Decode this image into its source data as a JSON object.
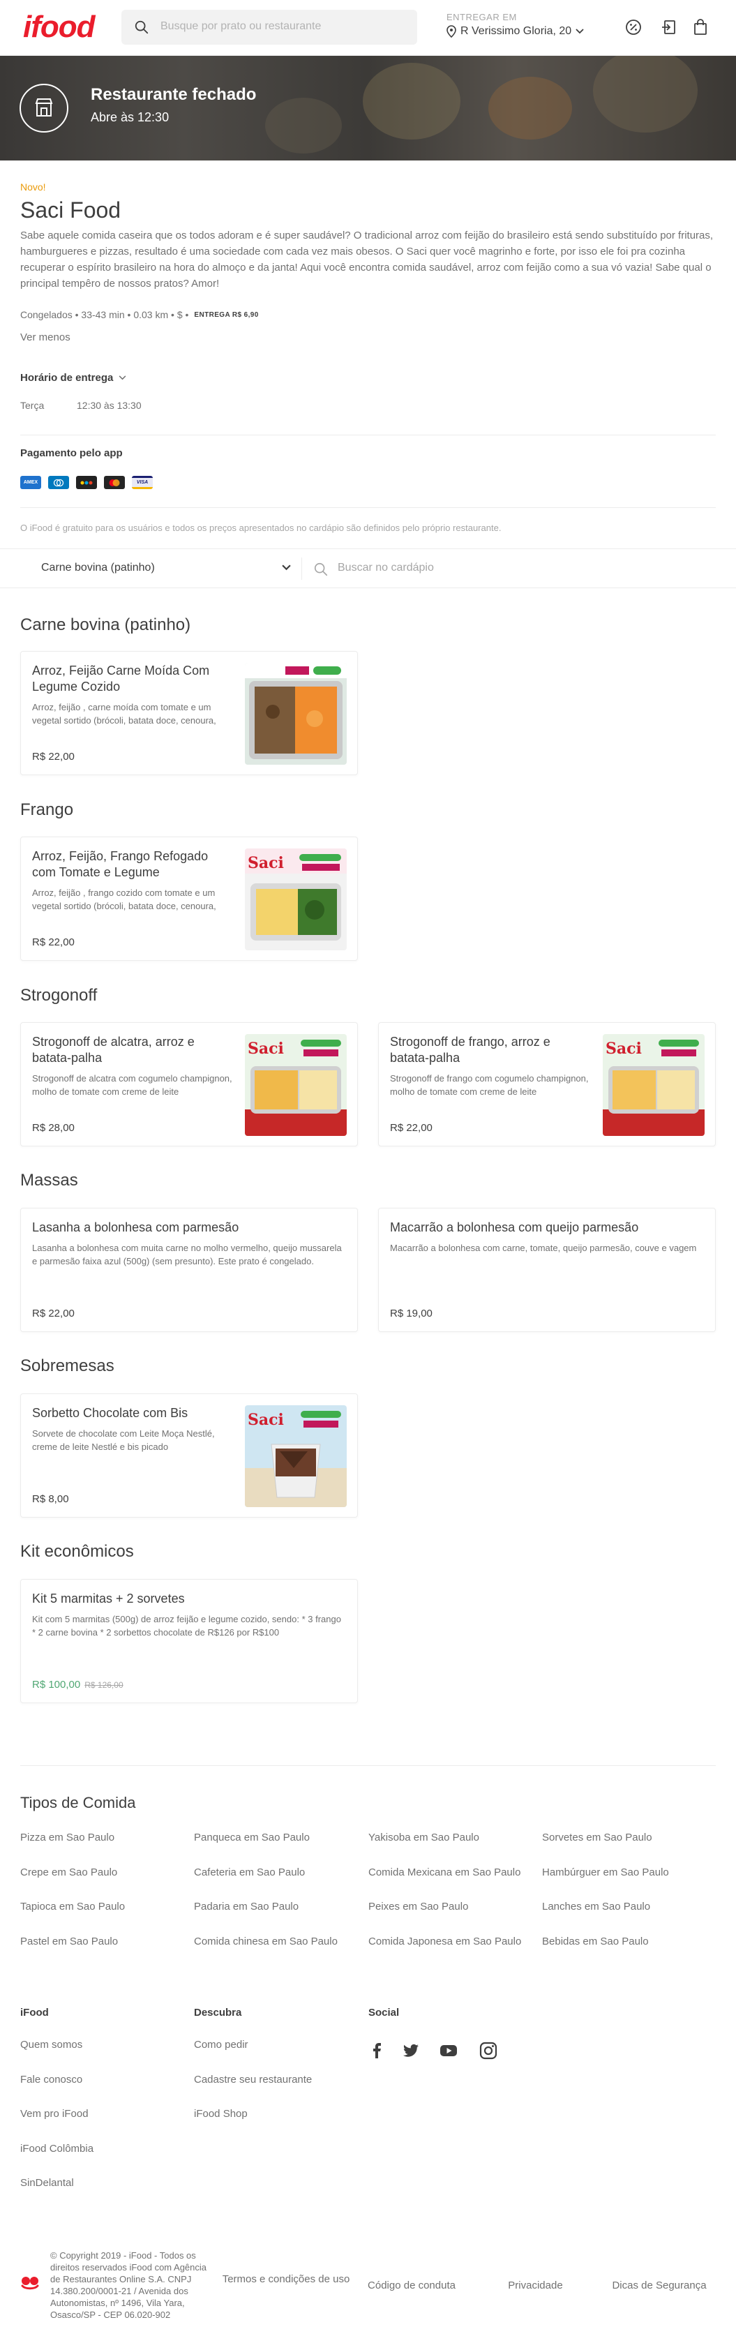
{
  "header": {
    "logo": "ifood",
    "search_placeholder": "Busque por prato ou restaurante",
    "deliver_label": "ENTREGAR EM",
    "deliver_address": "R Verissimo Gloria, 20",
    "icons": [
      "discount-icon",
      "login-icon",
      "bag-icon"
    ]
  },
  "banner": {
    "title": "Restaurante fechado",
    "subtitle": "Abre às 12:30"
  },
  "restaurant": {
    "badge": "Novo!",
    "name": "Saci Food",
    "description": "Sabe aquele comida caseira que os todos adoram e é super saudável? O tradicional arroz com feijão do brasileiro está sendo substituído por frituras, hamburgueres e pizzas, resultado é uma sociedade com cada vez mais obesos. O Saci quer você magrinho e forte, por isso ele foi pra cozinha recuperar o espírito brasileiro na hora do almoço e da janta! Aqui você encontra comida saudável, arroz com feijão como a sua vó vazia! Sabe qual o principal tempêro de nossos pratos? Amor!",
    "meta": "Congelados • 33-43 min • 0.03 km • $ •",
    "delivery_fee": "ENTREGA R$ 6,90",
    "see_less": "Ver menos",
    "schedule_heading": "Horário de entrega",
    "schedule_day": "Terça",
    "schedule_hours": "12:30 às 13:30",
    "payment_heading": "Pagamento pelo app",
    "payment_cards": [
      {
        "label": "AMEX",
        "color": "#1f72cd"
      },
      {
        "label": "DINERS",
        "color": "#0079be"
      },
      {
        "label": "ELO",
        "color": "#222222"
      },
      {
        "label": "MC",
        "color": "#252525"
      },
      {
        "label": "VISA",
        "color": "#e9e9f5"
      }
    ],
    "disclaimer": "O iFood é gratuito para os usuários e todos os preços apresentados no cardápio são definidos pelo próprio restaurante."
  },
  "category_bar": {
    "selected": "Carne bovina (patinho)",
    "search_placeholder": "Buscar no cardápio"
  },
  "sections": [
    {
      "title": "Carne bovina (patinho)",
      "items": [
        {
          "name": "Arroz, Feijão Carne Moída Com Legume Cozido",
          "desc": "Arroz, feijão , carne moída com tomate e um vegetal sortido (brócoli, batata doce, cenoura, berinjela, abobrinha)",
          "price": "R$ 22,00"
        }
      ]
    },
    {
      "title": "Frango",
      "items": [
        {
          "name": "Arroz, Feijão, Frango Refogado com Tomate e Legume",
          "desc": "Arroz, feijão , frango cozido com tomate e um vegetal sortido (brócoli, batata doce, cenoura, berinjela, abobrinha)",
          "price": "R$ 22,00"
        }
      ]
    },
    {
      "title": "Strogonoff",
      "items": [
        {
          "name": "Strogonoff de alcatra, arroz e batata-palha",
          "desc": "Strogonoff de alcatra com cogumelo champignon, molho de tomate com creme de leite",
          "price": "R$ 28,00"
        },
        {
          "name": "Strogonoff de frango, arroz e batata-palha",
          "desc": "Strogonoff de frango com cogumelo champignon, molho de tomate com creme de leite",
          "price": "R$ 22,00"
        }
      ]
    },
    {
      "title": "Massas",
      "items": [
        {
          "name": "Lasanha a bolonhesa com parmesão",
          "desc": "Lasanha a bolonhesa com muita carne no molho vermelho, queijo mussarela e parmesão faixa azul (500g) (sem presunto). Este prato é congelado.",
          "price": "R$ 22,00"
        },
        {
          "name": "Macarrão a bolonhesa com queijo parmesão",
          "desc": "Macarrão a bolonhesa com carne, tomate, queijo parmesão, couve e vagem",
          "price": "R$ 19,00"
        }
      ]
    },
    {
      "title": "Sobremesas",
      "items": [
        {
          "name": "Sorbetto Chocolate com Bis",
          "desc": "Sorvete de chocolate com Leite Moça Nestlé, creme de leite Nestlé e bis picado",
          "price": "R$ 8,00"
        }
      ]
    },
    {
      "title": "Kit econômicos",
      "items": [
        {
          "name": "Kit 5 marmitas + 2 sorvetes",
          "desc": "Kit com 5 marmitas (500g) de arroz feijão e legume cozido, sendo: * 3 frango * 2 carne bovina * 2 sorbettos chocolate de R$126 por R$100",
          "price": "R$ 100,00",
          "old_price": "R$ 126,00"
        }
      ]
    }
  ],
  "footer": {
    "tipos_heading": "Tipos de Comida",
    "tipos": [
      "Pizza em Sao Paulo",
      "Panqueca em Sao Paulo",
      "Yakisoba em Sao Paulo",
      "Sorvetes em Sao Paulo",
      "Crepe em Sao Paulo",
      "Cafeteria em Sao Paulo",
      "Comida Mexicana em Sao Paulo",
      "Hambúrguer em Sao Paulo",
      "Tapioca em Sao Paulo",
      "Padaria em Sao Paulo",
      "Peixes em Sao Paulo",
      "Lanches em Sao Paulo",
      "Pastel em Sao Paulo",
      "Comida chinesa em Sao Paulo",
      "Comida Japonesa em Sao Paulo",
      "Bebidas em Sao Paulo"
    ],
    "col1_heading": "iFood",
    "col1_links": [
      "Quem somos",
      "Fale conosco",
      "Vem pro iFood",
      "iFood Colômbia",
      "SinDelantal"
    ],
    "col2_heading": "Descubra",
    "col2_links": [
      "Como pedir",
      "Cadastre seu restaurante",
      "iFood Shop"
    ],
    "col3_heading": "Social",
    "social_icons": [
      "facebook-icon",
      "twitter-icon",
      "youtube-icon",
      "instagram-icon"
    ],
    "copyright": "© Copyright 2019 - iFood - Todos os direitos reservados iFood com Agência de Restaurantes Online S.A. CNPJ 14.380.200/0001-21 / Avenida dos Autonomistas, nº 1496, Vila Yara, Osasco/SP - CEP 06.020-902",
    "bottom_links": [
      "Termos e condições de uso",
      "Código de conduta",
      "Privacidade",
      "Dicas de Segurança"
    ]
  },
  "colors": {
    "brand": "#ea1d2c",
    "promo_price": "#50a773",
    "new_badge": "#ea9a0a"
  }
}
